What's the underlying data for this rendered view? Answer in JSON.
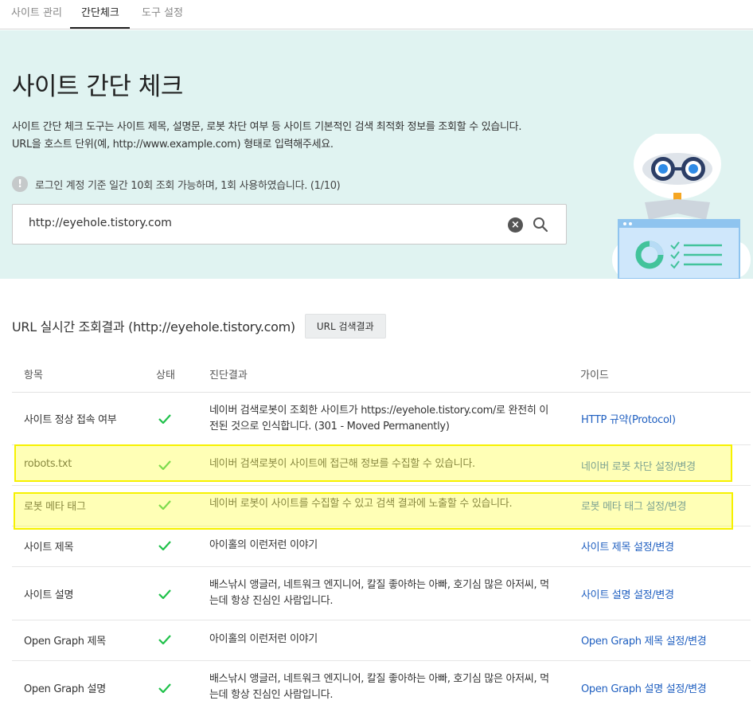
{
  "tabs": [
    {
      "label": "사이트 관리"
    },
    {
      "label": "간단체크"
    },
    {
      "label": "도구 설정"
    }
  ],
  "hero": {
    "title": "사이트 간단 체크",
    "desc_line1": "사이트 간단 체크 도구는 사이트 제목, 설명문, 로봇 차단 여부 등 사이트 기본적인 검색 최적화 정보를 조회할 수 있습니다.",
    "desc_line2": "URL을 호스트 단위(예, http://www.example.com) 형태로 입력해주세요.",
    "quota_icon": "!",
    "quota_text": "로그인 계정 기준 일간 10회 조회 가능하며, 1회 사용하였습니다. (1/10)",
    "search_value": "http://eyehole.tistory.com"
  },
  "result": {
    "title": "URL 실시간 조회결과 (http://eyehole.tistory.com)",
    "button_label": "URL 검색결과"
  },
  "table": {
    "headers": {
      "item": "항목",
      "status": "상태",
      "result": "진단결과",
      "guide": "가이드"
    },
    "rows": [
      {
        "item": "사이트 정상 접속 여부",
        "result_line1": "네이버 검색로봇이 조회한 사이트가 https://eyehole.tistory.com/로 완전히 이",
        "result_line2": "전된 것으로 인식합니다. (301 - Moved Permanently)",
        "guide": "HTTP 규약(Protocol)"
      },
      {
        "item": "robots.txt",
        "result_line1": "네이버 검색로봇이 사이트에 접근해 정보를 수집할 수 있습니다.",
        "guide": "네이버 로봇 차단 설정/변경"
      },
      {
        "item": "로봇 메타 태그",
        "result_line1": "네이버 로봇이 사이트를 수집할 수 있고 검색 결과에 노출할 수 있습니다.",
        "guide": "로봇 메타 태그 설정/변경"
      },
      {
        "item": "사이트 제목",
        "result_line1": "아이홀의 이런저런 이야기",
        "guide": "사이트 제목 설정/변경"
      },
      {
        "item": "사이트 설명",
        "result_line1": "배스낚시 앵글러, 네트워크 엔지니어, 칼질 좋아하는 아빠, 호기심 많은 아저씨, 먹",
        "result_line2": "는데 항상 진심인 사람입니다.",
        "guide": "사이트 설명 설정/변경"
      },
      {
        "item": "Open Graph 제목",
        "result_line1": "아이홀의 이런저런 이야기",
        "guide": "Open Graph 제목 설정/변경"
      },
      {
        "item": "Open Graph 설명",
        "result_line1": "배스낚시 앵글러, 네트워크 엔지니어, 칼질 좋아하는 아빠, 호기심 많은 아저씨, 먹",
        "result_line2": "는데 항상 진심인 사람입니다.",
        "guide": "Open Graph 설명 설정/변경"
      }
    ]
  },
  "colors": {
    "hero_bg": "#e0f3f1",
    "check": "#1fc14a",
    "link": "#1f5fc0",
    "highlight": "#f6f100"
  }
}
